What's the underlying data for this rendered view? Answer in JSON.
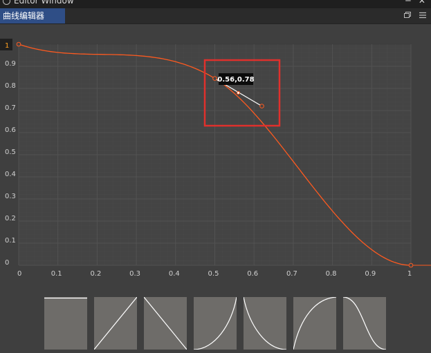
{
  "window": {
    "title": "Editor Window"
  },
  "tab": {
    "label": "曲线编辑器"
  },
  "tab_icons": [
    "restore-icon",
    "menu-icon"
  ],
  "colors": {
    "curve": "#ff5a1f",
    "handle": "#ffffff",
    "highlight": "#e0302c",
    "grid": "#525252",
    "plot_bg": "#444444"
  },
  "chart_data": {
    "type": "line",
    "xlim": [
      0,
      1
    ],
    "ylim": [
      0,
      1
    ],
    "x_ticks": [
      "0",
      "0.1",
      "0.2",
      "0.3",
      "0.4",
      "0.5",
      "0.6",
      "0.7",
      "0.8",
      "0.9",
      "1"
    ],
    "y_ticks": [
      "0",
      "0.1",
      "0.2",
      "0.3",
      "0.4",
      "0.5",
      "0.6",
      "0.7",
      "0.8",
      "0.9"
    ],
    "top_y_label": "1",
    "keyframes": [
      {
        "x": 0,
        "y": 1
      },
      {
        "x": 0.5,
        "y": 0.845
      },
      {
        "x": 1,
        "y": 0
      }
    ],
    "tangent_handles": [
      {
        "x": 0.56,
        "y": 0.78
      },
      {
        "x": 0.62,
        "y": 0.72
      }
    ],
    "tooltip": "0.56,0.78",
    "grid": true
  },
  "presets": [
    "constant",
    "linear-in",
    "linear-out",
    "ease-in",
    "ease-out",
    "ease-out-sine",
    "ease-in-out"
  ]
}
